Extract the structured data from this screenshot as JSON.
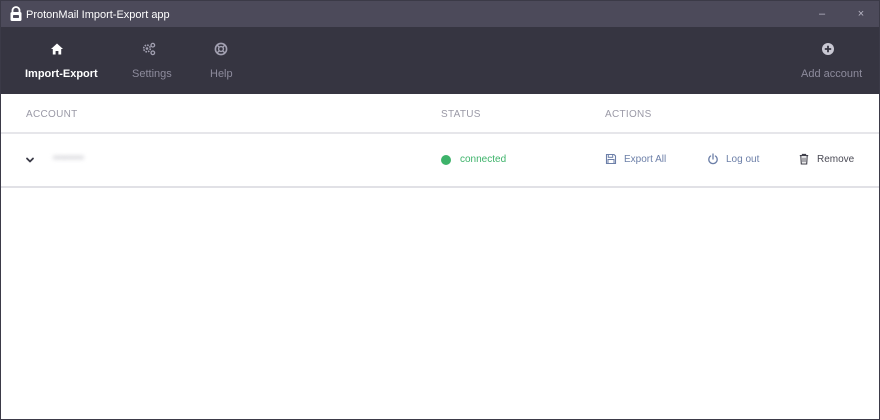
{
  "window": {
    "title": "ProtonMail Import-Export app",
    "minimize_label": "–",
    "close_label": "×"
  },
  "nav": {
    "items": [
      {
        "label": "Import-Export",
        "icon": "home-icon",
        "active": true
      },
      {
        "label": "Settings",
        "icon": "gears-icon",
        "active": false
      },
      {
        "label": "Help",
        "icon": "lifebuoy-icon",
        "active": false
      }
    ],
    "add_account": {
      "label": "Add account",
      "icon": "plus-circle-icon"
    }
  },
  "table": {
    "columns": [
      "ACCOUNT",
      "STATUS",
      "ACTIONS"
    ],
    "rows": [
      {
        "account": "••••••••",
        "status": "connected",
        "actions": [
          {
            "label": "Export All",
            "icon": "save-icon"
          },
          {
            "label": "Log out",
            "icon": "power-icon"
          },
          {
            "label": "Remove",
            "icon": "trash-icon"
          }
        ]
      }
    ]
  },
  "colors": {
    "titlebar": "#4c4a5a",
    "navbar": "#363541",
    "connected": "#3db36a",
    "action_link": "#6c7fa8"
  }
}
